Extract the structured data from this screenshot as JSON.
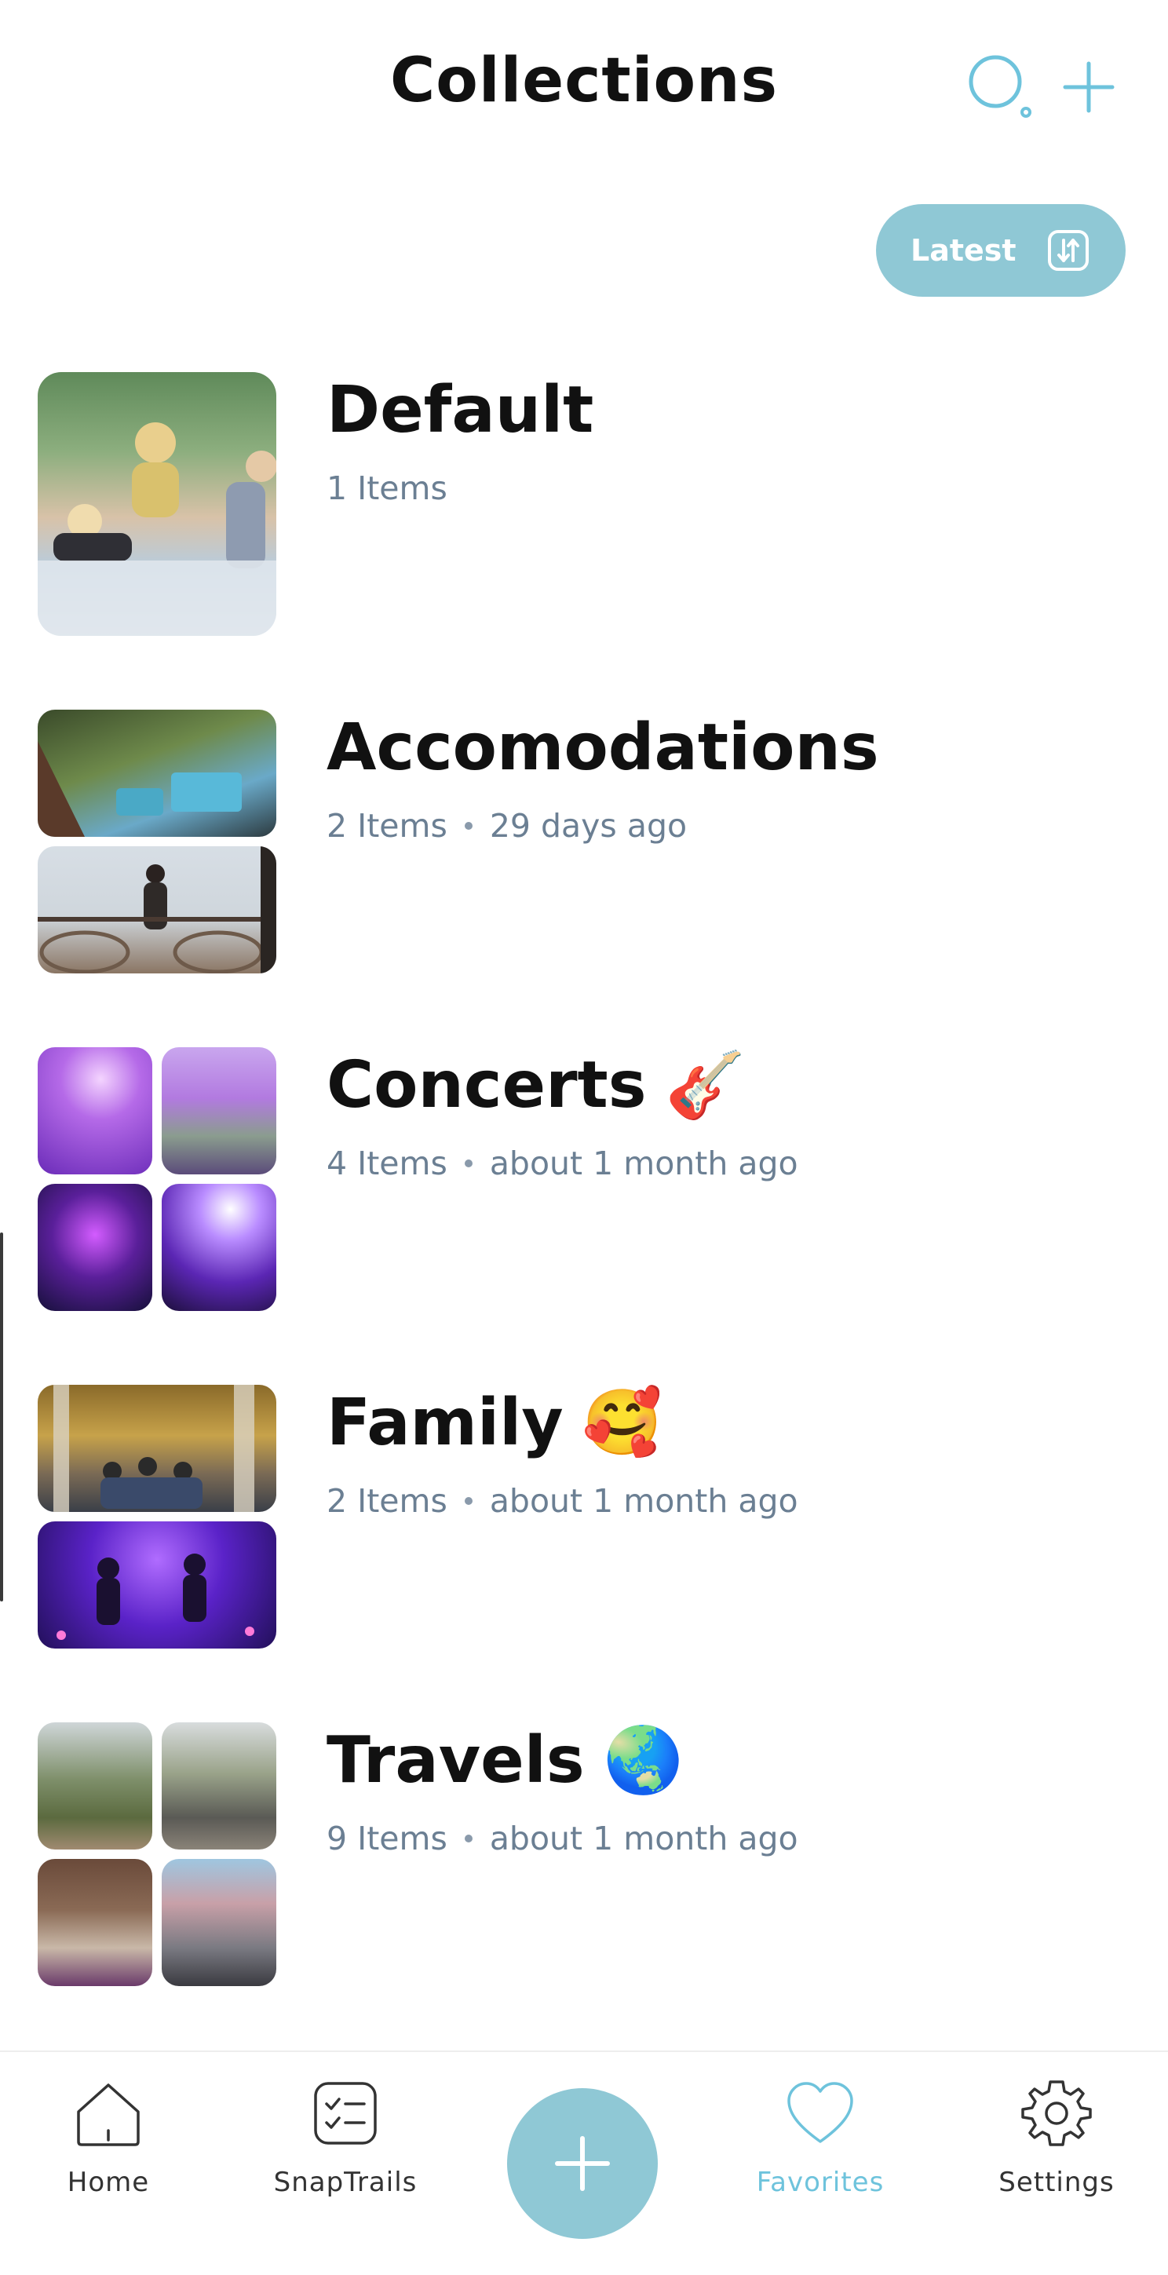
{
  "header": {
    "title": "Collections",
    "search_icon": "search-icon",
    "add_icon": "plus-icon"
  },
  "sort": {
    "label": "Latest",
    "icon": "sort-toggle-icon"
  },
  "collections": [
    {
      "name": "Default",
      "emoji": "",
      "meta": [
        "1 Items"
      ]
    },
    {
      "name": "Accomodations",
      "emoji": "",
      "meta": [
        "2 Items",
        "29 days ago"
      ]
    },
    {
      "name": "Concerts",
      "emoji": "🎸",
      "meta": [
        "4 Items",
        "about 1 month ago"
      ]
    },
    {
      "name": "Family",
      "emoji": "🥰",
      "meta": [
        "2 Items",
        "about 1 month ago"
      ]
    },
    {
      "name": "Travels",
      "emoji": "🌏",
      "meta": [
        "9 Items",
        "about 1 month ago"
      ]
    }
  ],
  "tabbar": {
    "home": {
      "label": "Home",
      "icon": "home-icon"
    },
    "snaptrails": {
      "label": "SnapTrails",
      "icon": "checklist-icon"
    },
    "add": {
      "icon": "plus-icon"
    },
    "favorites": {
      "label": "Favorites",
      "icon": "heart-icon",
      "active": true
    },
    "settings": {
      "label": "Settings",
      "icon": "gear-icon"
    }
  },
  "colors": {
    "accent": "#6ec3dc",
    "pill": "#8fc8d5",
    "meta_text": "#6b7f93"
  }
}
